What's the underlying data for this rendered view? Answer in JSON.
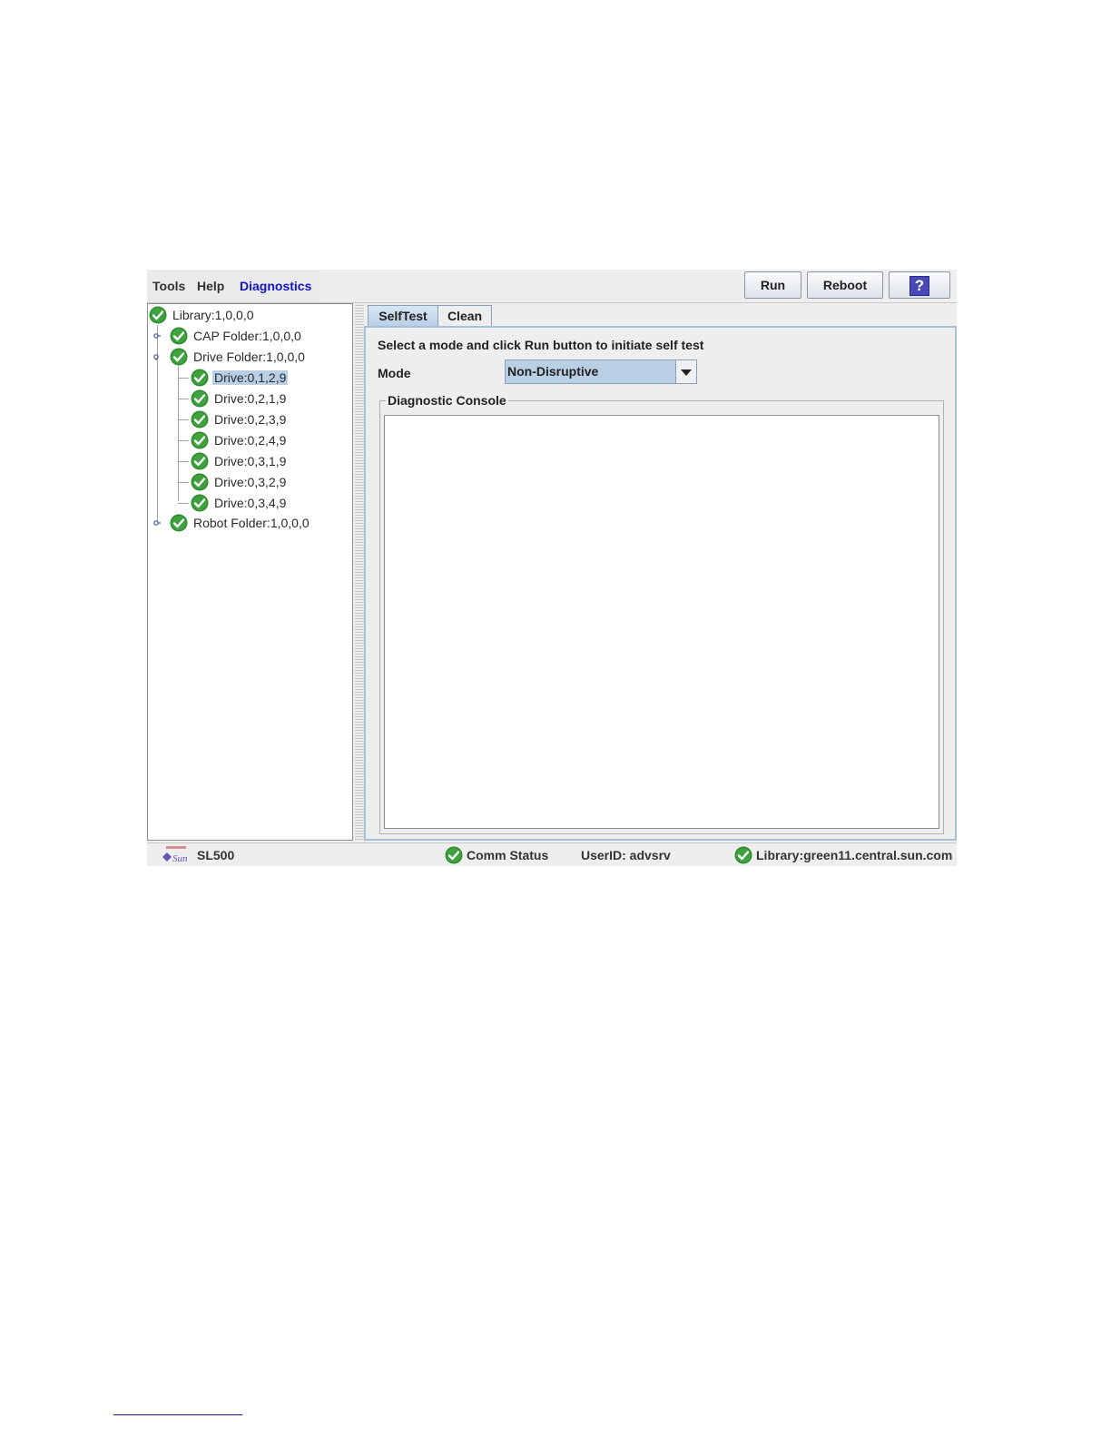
{
  "menu": {
    "tools": "Tools",
    "help": "Help",
    "diagnostics": "Diagnostics"
  },
  "toolbar": {
    "run": "Run",
    "reboot": "Reboot",
    "help_glyph": "?"
  },
  "tree": {
    "root": "Library:1,0,0,0",
    "cap_folder": "CAP Folder:1,0,0,0",
    "drive_folder": "Drive Folder:1,0,0,0",
    "drives": [
      "Drive:0,1,2,9",
      "Drive:0,2,1,9",
      "Drive:0,2,3,9",
      "Drive:0,2,4,9",
      "Drive:0,3,1,9",
      "Drive:0,3,2,9",
      "Drive:0,3,4,9"
    ],
    "selected": "Drive:0,1,2,9",
    "robot_folder": "Robot Folder:1,0,0,0",
    "status_icon": "green-check-icon"
  },
  "tabs": {
    "selftest": "SelfTest",
    "clean": "Clean",
    "active": "SelfTest"
  },
  "selftest": {
    "prompt": "Select a mode and click Run button to initiate self test",
    "mode_label": "Mode",
    "mode_value": "Non-Disruptive",
    "console_title": "Diagnostic Console"
  },
  "status_bar": {
    "product": "SL500",
    "comm_status": "Comm Status",
    "user": "UserID: advsrv",
    "library": "Library:green11.central.sun.com"
  },
  "colors": {
    "accent": "#1414c8",
    "selection": "#b8cfe5",
    "check": "#2e8b2e"
  }
}
